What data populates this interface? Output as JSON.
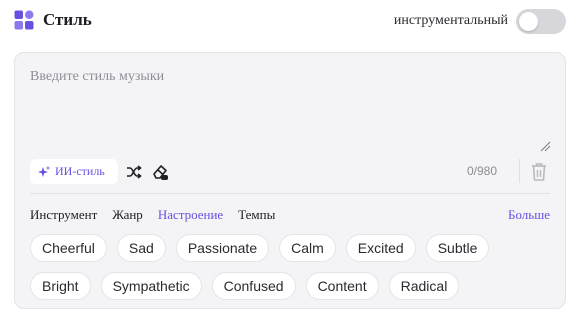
{
  "header": {
    "title": "Стиль",
    "icon": "grid-icon",
    "instrumental_label": "инструментальный",
    "instrumental_on": false
  },
  "editor": {
    "placeholder": "Введите стиль музыки",
    "value": "",
    "ai_button_label": "ИИ-стиль",
    "counter": "0/980"
  },
  "tabs": [
    {
      "label": "Инструмент",
      "active": false
    },
    {
      "label": "Жанр",
      "active": false
    },
    {
      "label": "Настроение",
      "active": true
    },
    {
      "label": "Темпы",
      "active": false
    }
  ],
  "more_label": "Больше",
  "tags_row1": [
    "Cheerful",
    "Sad",
    "Passionate",
    "Calm",
    "Excited",
    "Subtle"
  ],
  "tags_row2": [
    "Bright",
    "Sympathetic",
    "Confused",
    "Content",
    "Radical"
  ],
  "colors": {
    "accent": "#6a50e0",
    "toggle_off": "#d6d6db",
    "panel_bg": "#f4f4f6"
  }
}
